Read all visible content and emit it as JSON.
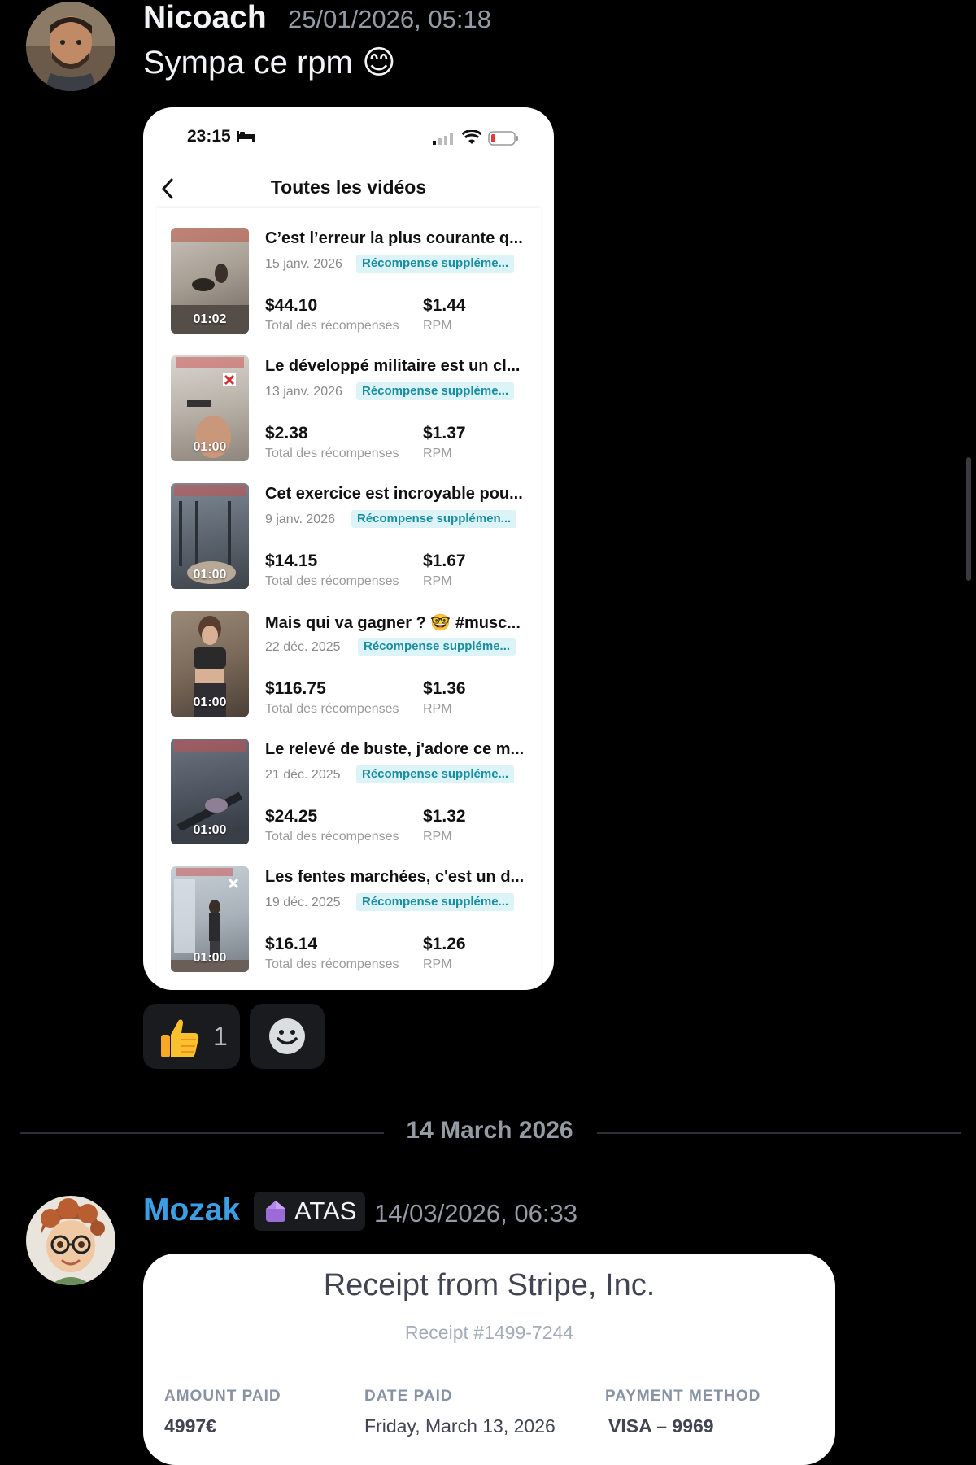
{
  "message1": {
    "username": "Nicoach",
    "username_color": "#f2f3f5",
    "timestamp": "25/01/2026, 05:18",
    "text": "Sympa ce rpm 😊",
    "phone": {
      "time": "23:15",
      "nav_title": "Toutes les vidéos",
      "videos": [
        {
          "title": "C’est l’erreur la plus courante q...",
          "date": "15 janv. 2026",
          "badge": "Récompense suppléme...",
          "duration": "01:02",
          "total": "$44.10",
          "total_label": "Total des récompenses",
          "rpm": "$1.44",
          "rpm_label": "RPM"
        },
        {
          "title": "Le développé militaire est un cl...",
          "date": "13 janv. 2026",
          "badge": "Récompense suppléme...",
          "duration": "01:00",
          "total": "$2.38",
          "total_label": "Total des récompenses",
          "rpm": "$1.37",
          "rpm_label": "RPM"
        },
        {
          "title": "Cet exercice est incroyable pou...",
          "date": "9 janv. 2026",
          "badge": "Récompense supplémen...",
          "duration": "01:00",
          "total": "$14.15",
          "total_label": "Total des récompenses",
          "rpm": "$1.67",
          "rpm_label": "RPM"
        },
        {
          "title": "Mais qui va gagner ? 🤓 #musc...",
          "date": "22 déc. 2025",
          "badge": "Récompense suppléme...",
          "duration": "01:00",
          "total": "$116.75",
          "total_label": "Total des récompenses",
          "rpm": "$1.36",
          "rpm_label": "RPM"
        },
        {
          "title": "Le relevé de buste, j'adore ce m...",
          "date": "21 déc. 2025",
          "badge": "Récompense suppléme...",
          "duration": "01:00",
          "total": "$24.25",
          "total_label": "Total des récompenses",
          "rpm": "$1.32",
          "rpm_label": "RPM"
        },
        {
          "title": "Les fentes marchées, c'est un d...",
          "date": "19 déc. 2025",
          "badge": "Récompense suppléme...",
          "duration": "01:00",
          "total": "$16.14",
          "total_label": "Total des récompenses",
          "rpm": "$1.26",
          "rpm_label": "RPM"
        }
      ]
    },
    "reactions": [
      {
        "emoji": "thumbs-up",
        "count": "1"
      },
      {
        "emoji": "add-reaction"
      }
    ]
  },
  "date_divider": "14 March 2026",
  "message2": {
    "username": "Mozak",
    "username_color": "#3b9fe6",
    "role_tag": "ATAS",
    "timestamp": "14/03/2026, 06:33",
    "receipt": {
      "title": "Receipt from Stripe, Inc.",
      "number": "Receipt #1499-7244",
      "amount_label": "AMOUNT PAID",
      "amount_value": "4997€",
      "date_label": "DATE PAID",
      "date_value": "Friday, March 13, 2026",
      "method_label": "PAYMENT METHOD",
      "method_value": "VISA – 9969"
    }
  },
  "colors": {
    "background": "#000000",
    "badge_bg": "#dcf4f8",
    "badge_text": "#1a8da0",
    "muted": "#949ba4"
  }
}
